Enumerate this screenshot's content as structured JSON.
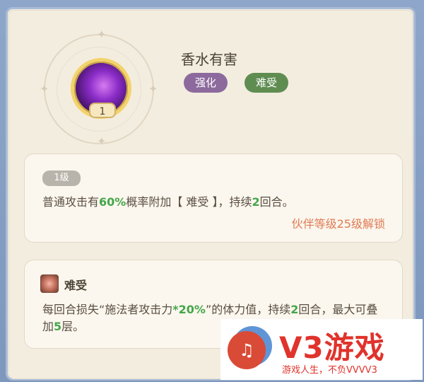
{
  "skill": {
    "name": "香水有害",
    "icon": "perfume-skill-icon",
    "level_badge": "1",
    "tags": [
      "强化",
      "难受"
    ]
  },
  "level_card": {
    "level_label": "1级",
    "description_parts": [
      "普通攻击有",
      "60%",
      "概率附加【 难受 】，持续",
      "2",
      "回合。"
    ],
    "unlock_text": "伙伴等级25级解锁"
  },
  "debuff_card": {
    "icon": "debuff-icon",
    "name": "难受",
    "description_parts": [
      "每回合损失“施法者攻击力",
      "*20%",
      "”的体力值，持续",
      "2",
      "回合，最大可叠加",
      "5",
      "层。"
    ]
  },
  "watermark": {
    "brand": "V3游戏",
    "slogan": "游戏人生，不负VVVV3"
  },
  "colors": {
    "highlight_green": "#44a64a",
    "unlock_orange": "#e17a55",
    "tag_purple": "#8d6a9d",
    "tag_green": "#5f8d51"
  }
}
